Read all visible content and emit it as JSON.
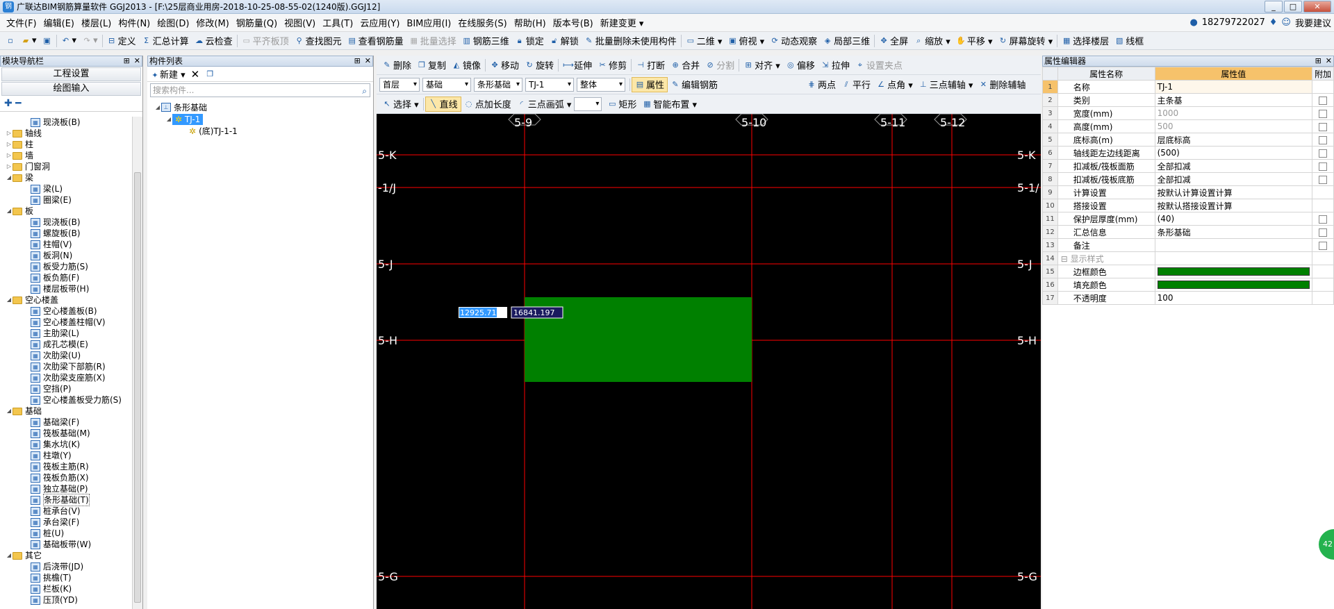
{
  "window": {
    "title": "广联达BIM钢筋算量软件 GGJ2013 - [F:\\25层商业用房-2018-10-25-08-55-02(1240版).GGJ12]",
    "app_icon": "钢",
    "controls": [
      "_",
      "□",
      "✕"
    ]
  },
  "menu": {
    "items": [
      "文件(F)",
      "编辑(E)",
      "楼层(L)",
      "构件(N)",
      "绘图(D)",
      "修改(M)",
      "钢筋量(Q)",
      "视图(V)",
      "工具(T)",
      "云应用(Y)",
      "BIM应用(I)",
      "在线服务(S)",
      "帮助(H)",
      "版本号(B)",
      "新建变更 ▾"
    ],
    "phone": "18279722027",
    "feedback": "我要建议"
  },
  "toolbar1": {
    "items": [
      {
        "label": "定义",
        "icon": "define-icon",
        "disabled": false
      },
      {
        "label": "汇总计算",
        "icon": "sigma-icon",
        "disabled": false
      },
      {
        "label": "云检查",
        "icon": "cloud-check-icon",
        "disabled": false
      },
      {
        "label": "平齐板顶",
        "icon": "align-slab-icon",
        "disabled": true
      },
      {
        "label": "查找图元",
        "icon": "find-icon",
        "disabled": false
      },
      {
        "label": "查看钢筋量",
        "icon": "view-rebar-icon",
        "disabled": false
      },
      {
        "label": "批量选择",
        "icon": "batch-select-icon",
        "disabled": true
      },
      {
        "label": "钢筋三维",
        "icon": "rebar-3d-icon",
        "disabled": false
      },
      {
        "label": "锁定",
        "icon": "lock-icon",
        "disabled": false
      },
      {
        "label": "解锁",
        "icon": "unlock-icon",
        "disabled": false
      },
      {
        "label": "批量删除未使用构件",
        "icon": "batch-delete-icon",
        "disabled": false
      },
      {
        "label": "二维 ▾",
        "icon": "2d-icon",
        "disabled": false
      },
      {
        "label": "俯视 ▾",
        "icon": "top-view-icon",
        "disabled": false
      },
      {
        "label": "动态观察",
        "icon": "orbit-icon",
        "disabled": false
      },
      {
        "label": "局部三维",
        "icon": "local-3d-icon",
        "disabled": false
      },
      {
        "label": "全屏",
        "icon": "fullscreen-icon",
        "disabled": false
      },
      {
        "label": "缩放 ▾",
        "icon": "zoom-icon",
        "disabled": false
      },
      {
        "label": "平移 ▾",
        "icon": "pan-icon",
        "disabled": false
      },
      {
        "label": "屏幕旋转 ▾",
        "icon": "rotate-screen-icon",
        "disabled": false
      },
      {
        "label": "选择楼层",
        "icon": "floor-select-icon",
        "disabled": false
      },
      {
        "label": "线框",
        "icon": "wireframe-icon",
        "disabled": false
      }
    ]
  },
  "nav": {
    "header": "模块导航栏",
    "btn_project": "工程设置",
    "btn_draw": "绘图输入",
    "tree": [
      {
        "level": 2,
        "type": "leaf",
        "label": "现浇板(B)"
      },
      {
        "level": 1,
        "type": "folder",
        "label": "轴线",
        "expanded": false
      },
      {
        "level": 1,
        "type": "folder",
        "label": "柱",
        "expanded": false
      },
      {
        "level": 1,
        "type": "folder",
        "label": "墙",
        "expanded": false
      },
      {
        "level": 1,
        "type": "folder",
        "label": "门窗洞",
        "expanded": false
      },
      {
        "level": 1,
        "type": "folder",
        "label": "梁",
        "expanded": true
      },
      {
        "level": 2,
        "type": "leaf",
        "label": "梁(L)"
      },
      {
        "level": 2,
        "type": "leaf",
        "label": "圈梁(E)"
      },
      {
        "level": 1,
        "type": "folder",
        "label": "板",
        "expanded": true
      },
      {
        "level": 2,
        "type": "leaf",
        "label": "现浇板(B)"
      },
      {
        "level": 2,
        "type": "leaf",
        "label": "螺旋板(B)"
      },
      {
        "level": 2,
        "type": "leaf",
        "label": "柱帽(V)"
      },
      {
        "level": 2,
        "type": "leaf",
        "label": "板洞(N)"
      },
      {
        "level": 2,
        "type": "leaf",
        "label": "板受力筋(S)"
      },
      {
        "level": 2,
        "type": "leaf",
        "label": "板负筋(F)"
      },
      {
        "level": 2,
        "type": "leaf",
        "label": "楼层板带(H)"
      },
      {
        "level": 1,
        "type": "folder",
        "label": "空心楼盖",
        "expanded": true
      },
      {
        "level": 2,
        "type": "leaf",
        "label": "空心楼盖板(B)"
      },
      {
        "level": 2,
        "type": "leaf",
        "label": "空心楼盖柱帽(V)"
      },
      {
        "level": 2,
        "type": "leaf",
        "label": "主肋梁(L)"
      },
      {
        "level": 2,
        "type": "leaf",
        "label": "成孔芯模(E)"
      },
      {
        "level": 2,
        "type": "leaf",
        "label": "次肋梁(U)"
      },
      {
        "level": 2,
        "type": "leaf",
        "label": "次肋梁下部筋(R)"
      },
      {
        "level": 2,
        "type": "leaf",
        "label": "次肋梁支座筋(X)"
      },
      {
        "level": 2,
        "type": "leaf",
        "label": "空挡(P)"
      },
      {
        "level": 2,
        "type": "leaf",
        "label": "空心楼盖板受力筋(S)"
      },
      {
        "level": 1,
        "type": "folder",
        "label": "基础",
        "expanded": true
      },
      {
        "level": 2,
        "type": "leaf",
        "label": "基础梁(F)"
      },
      {
        "level": 2,
        "type": "leaf",
        "label": "筏板基础(M)"
      },
      {
        "level": 2,
        "type": "leaf",
        "label": "集水坑(K)"
      },
      {
        "level": 2,
        "type": "leaf",
        "label": "柱墩(Y)"
      },
      {
        "level": 2,
        "type": "leaf",
        "label": "筏板主筋(R)"
      },
      {
        "level": 2,
        "type": "leaf",
        "label": "筏板负筋(X)"
      },
      {
        "level": 2,
        "type": "leaf",
        "label": "独立基础(P)"
      },
      {
        "level": 2,
        "type": "leaf",
        "label": "条形基础(T)",
        "selected": true
      },
      {
        "level": 2,
        "type": "leaf",
        "label": "桩承台(V)"
      },
      {
        "level": 2,
        "type": "leaf",
        "label": "承台梁(F)"
      },
      {
        "level": 2,
        "type": "leaf",
        "label": "桩(U)"
      },
      {
        "level": 2,
        "type": "leaf",
        "label": "基础板带(W)"
      },
      {
        "level": 1,
        "type": "folder",
        "label": "其它",
        "expanded": true
      },
      {
        "level": 2,
        "type": "leaf",
        "label": "后浇带(JD)"
      },
      {
        "level": 2,
        "type": "leaf",
        "label": "挑檐(T)"
      },
      {
        "level": 2,
        "type": "leaf",
        "label": "栏板(K)"
      },
      {
        "level": 2,
        "type": "leaf",
        "label": "压顶(YD)"
      }
    ]
  },
  "components": {
    "header": "构件列表",
    "new_label": "新建 ▾",
    "search_placeholder": "搜索构件...",
    "tree": {
      "root": "条形基础",
      "child": "TJ-1",
      "grandchild": "(底)TJ-1-1"
    }
  },
  "edit_toolbar": {
    "row1": [
      "删除",
      "复制",
      "镜像",
      "移动",
      "旋转",
      "延伸",
      "修剪",
      "打断",
      "合并",
      "分割",
      "对齐 ▾",
      "偏移",
      "拉伸",
      "设置夹点"
    ],
    "row1_disabled": [
      "分割",
      "设置夹点"
    ],
    "row2_dropdowns": [
      "首层",
      "基础",
      "条形基础",
      "TJ-1",
      "整体"
    ],
    "row2_items": [
      "属性",
      "编辑钢筋",
      "两点",
      "平行",
      "点角 ▾",
      "三点辅轴 ▾",
      "删除辅轴"
    ],
    "row3": [
      "选择 ▾",
      "直线",
      "点加长度",
      "三点画弧 ▾",
      "矩形",
      "智能布置 ▾"
    ]
  },
  "canvas": {
    "background": "#000000",
    "axis_color": "#ff0000",
    "label_color": "#ffffff",
    "vertical_axes": [
      "5-9",
      "5-10",
      "5-11",
      "5-12"
    ],
    "horizontal_axes": [
      "5-K",
      "5-1/J",
      "5-J",
      "5-H",
      "5-G"
    ],
    "right_labels": [
      "5-K",
      "5-1/",
      "5-J",
      "5-H",
      "5-G"
    ],
    "left_labels": [
      "5-K",
      "-1/J",
      "5-J",
      "5-H",
      "5-G"
    ],
    "fill_color": "#008000",
    "coord_x": "12925.713",
    "coord_y": "16841.197"
  },
  "properties": {
    "header": "属性编辑器",
    "col_name": "属性名称",
    "col_value": "属性值",
    "col_extra": "附加",
    "rows": [
      {
        "n": "1",
        "name": "名称",
        "value": "TJ-1",
        "dis": false,
        "cb": false
      },
      {
        "n": "2",
        "name": "类别",
        "value": "主条基",
        "dis": false,
        "cb": true
      },
      {
        "n": "3",
        "name": "宽度(mm)",
        "value": "1000",
        "dis": true,
        "cb": true
      },
      {
        "n": "4",
        "name": "高度(mm)",
        "value": "500",
        "dis": true,
        "cb": true
      },
      {
        "n": "5",
        "name": "底标高(m)",
        "value": "层底标高",
        "dis": false,
        "cb": true
      },
      {
        "n": "6",
        "name": "轴线距左边线距离",
        "value": "(500)",
        "dis": false,
        "cb": true
      },
      {
        "n": "7",
        "name": "扣减板/筏板面筋",
        "value": "全部扣减",
        "dis": false,
        "cb": true
      },
      {
        "n": "8",
        "name": "扣减板/筏板底筋",
        "value": "全部扣减",
        "dis": false,
        "cb": true
      },
      {
        "n": "9",
        "name": "计算设置",
        "value": "按默认计算设置计算",
        "dis": false,
        "cb": false
      },
      {
        "n": "10",
        "name": "搭接设置",
        "value": "按默认搭接设置计算",
        "dis": false,
        "cb": false
      },
      {
        "n": "11",
        "name": "保护层厚度(mm)",
        "value": "(40)",
        "dis": false,
        "cb": true
      },
      {
        "n": "12",
        "name": "汇总信息",
        "value": "条形基础",
        "dis": false,
        "cb": true
      },
      {
        "n": "13",
        "name": "备注",
        "value": "",
        "dis": false,
        "cb": true
      },
      {
        "n": "14",
        "name": "显示样式",
        "value": "",
        "dis": true,
        "cb": false
      },
      {
        "n": "15",
        "name": "边框颜色",
        "value": "",
        "dis": false,
        "cb": false
      },
      {
        "n": "16",
        "name": "填充颜色",
        "value": "",
        "dis": false,
        "cb": false
      },
      {
        "n": "17",
        "name": "不透明度",
        "value": "100",
        "dis": false,
        "cb": false
      }
    ]
  },
  "side_badge": "42"
}
